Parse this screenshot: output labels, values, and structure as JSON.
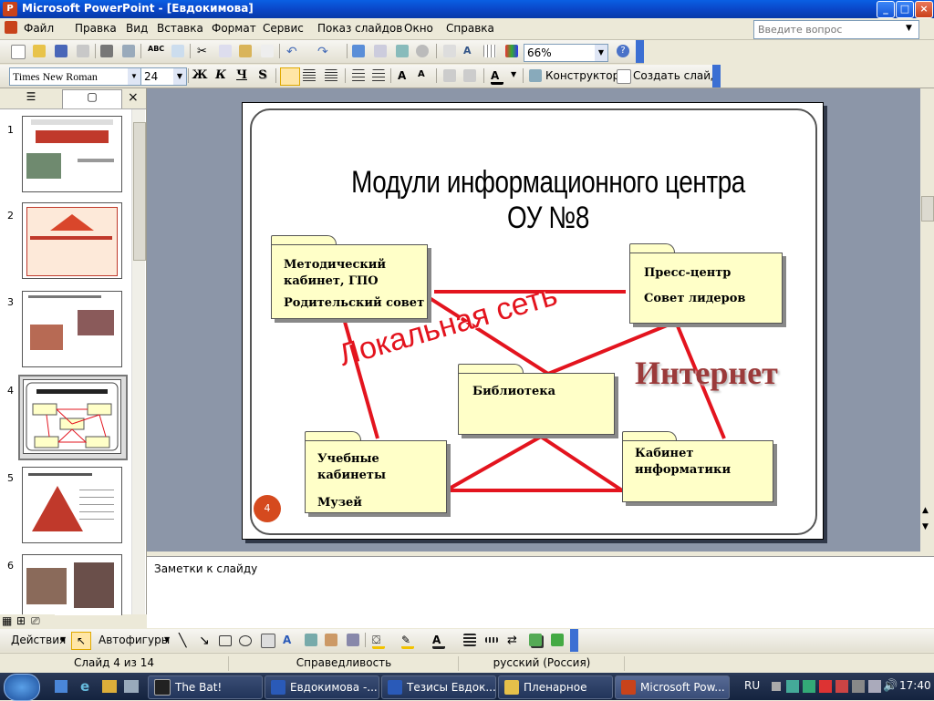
{
  "window": {
    "title": "Microsoft PowerPoint - [Евдокимова]",
    "app_icon": "powerpoint-icon"
  },
  "menu": {
    "items": [
      "Файл",
      "Правка",
      "Вид",
      "Вставка",
      "Формат",
      "Сервис",
      "Показ слайдов",
      "Окно",
      "Справка"
    ],
    "help_placeholder": "Введите вопрос"
  },
  "standard_toolbar": {
    "zoom": "66%"
  },
  "formatting_toolbar": {
    "font": "Times New Roman",
    "size": "24",
    "bold": "Ж",
    "italic": "К",
    "underline": "Ч",
    "shadow": "S",
    "designer": "Конструктор",
    "new_slide": "Создать слайд"
  },
  "slides_pane": {
    "numbers": [
      "1",
      "2",
      "3",
      "4",
      "5",
      "6"
    ],
    "selected": "4"
  },
  "slide": {
    "title": "Модули информационного центра ОУ №8",
    "local_network": "Локальная сеть",
    "internet": "Интернет",
    "slide_number": "4",
    "colors": {
      "lines": "#e3141e",
      "folder_fill": "#ffffc8",
      "internet_text": "#9b3a3a",
      "number_badge": "#d54a1e"
    },
    "folders": {
      "methodical": {
        "line1": "Методический",
        "line2": "кабинет,  ГПО",
        "line3": "Родительский совет"
      },
      "press": {
        "line1": "Пресс-центр",
        "line2": "Совет лидеров"
      },
      "library": {
        "line1": "Библиотека"
      },
      "classrooms": {
        "line1": "Учебные",
        "line2": "кабинеты",
        "line3": "Музей"
      },
      "informatics": {
        "line1": "Кабинет",
        "line2": "информатики"
      }
    }
  },
  "notes": {
    "placeholder": "Заметки к слайду"
  },
  "drawing_toolbar": {
    "actions": "Действия",
    "autoshapes": "Автофигуры"
  },
  "status": {
    "slide": "Слайд 4 из 14",
    "design": "Справедливость",
    "language": "русский (Россия)"
  },
  "taskbar": {
    "tasks": [
      "The Bat!",
      "Евдокимова -...",
      "Тезисы Евдок...",
      "Пленарное",
      "Microsoft Pow..."
    ],
    "lang": "RU",
    "clock": "17:40"
  }
}
